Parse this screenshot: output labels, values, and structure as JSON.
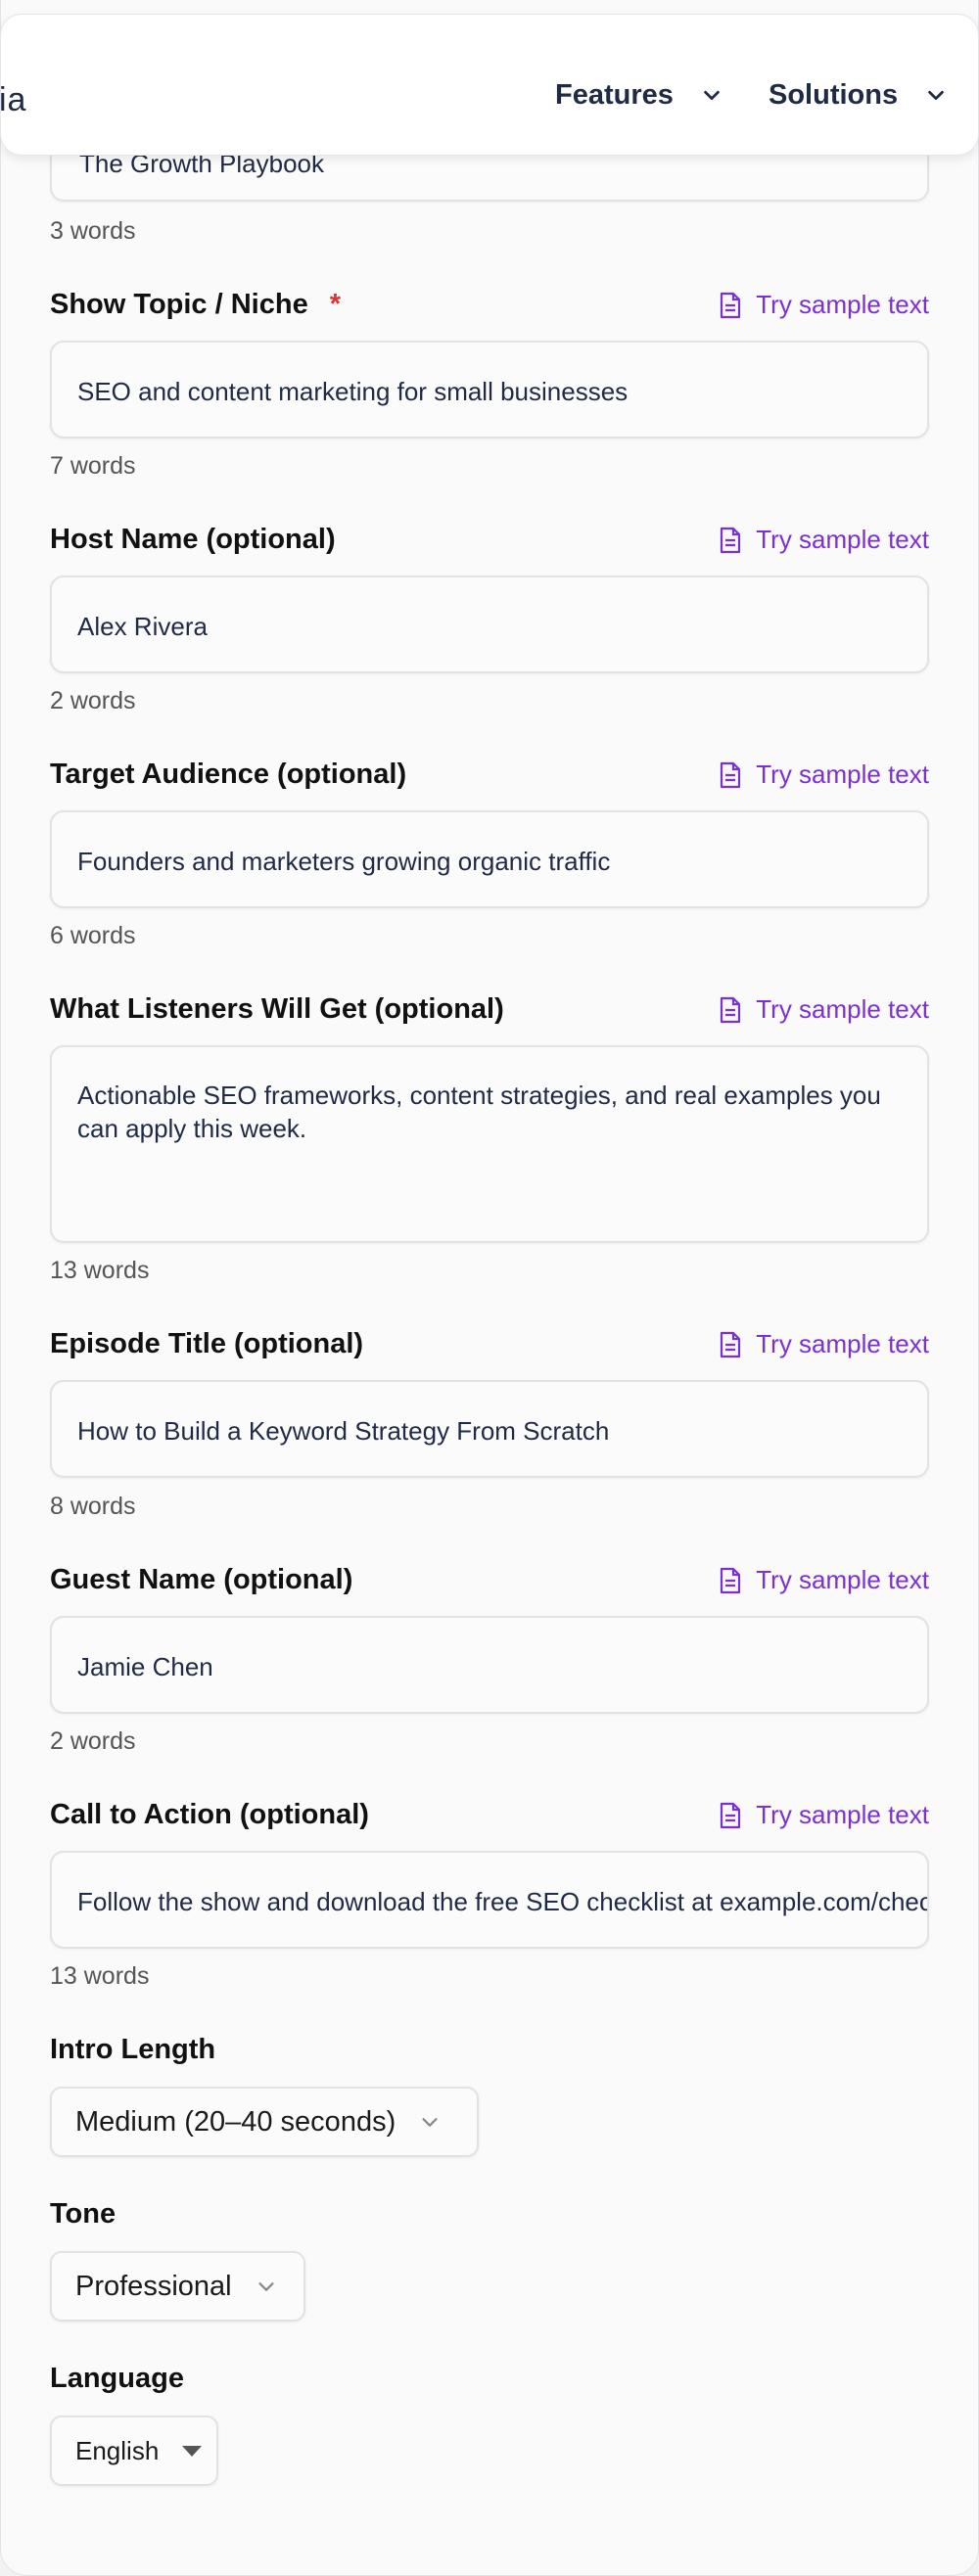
{
  "nav": {
    "logo_fragment": "ia",
    "items": [
      {
        "label": "Features"
      },
      {
        "label": "Solutions"
      }
    ]
  },
  "form": {
    "sample_link": "Try sample text",
    "show_name": {
      "value": "The Growth Playbook",
      "count": "3 words"
    },
    "show_topic": {
      "label": "Show Topic / Niche",
      "required": "*",
      "value": "SEO and content marketing for small businesses",
      "count": "7 words"
    },
    "host_name": {
      "label": "Host Name (optional)",
      "value": "Alex Rivera",
      "count": "2 words"
    },
    "target_audience": {
      "label": "Target Audience (optional)",
      "value": "Founders and marketers growing organic traffic",
      "count": "6 words"
    },
    "listeners_get": {
      "label": "What Listeners Will Get (optional)",
      "value": "Actionable SEO frameworks, content strategies, and real examples you can apply this week.",
      "count": "13 words"
    },
    "episode_title": {
      "label": "Episode Title (optional)",
      "value": "How to Build a Keyword Strategy From Scratch",
      "count": "8 words"
    },
    "guest_name": {
      "label": "Guest Name (optional)",
      "value": "Jamie Chen",
      "count": "2 words"
    },
    "cta": {
      "label": "Call to Action (optional)",
      "value": "Follow the show and download the free SEO checklist at example.com/checklist",
      "count": "13 words"
    },
    "intro_length": {
      "label": "Intro Length",
      "selected": "Medium (20–40 seconds)"
    },
    "tone": {
      "label": "Tone",
      "selected": "Professional"
    },
    "language": {
      "label": "Language",
      "selected": "English"
    }
  },
  "colors": {
    "accent": "#7b2fd9",
    "required": "#e03131",
    "text": "#1f2a44"
  }
}
